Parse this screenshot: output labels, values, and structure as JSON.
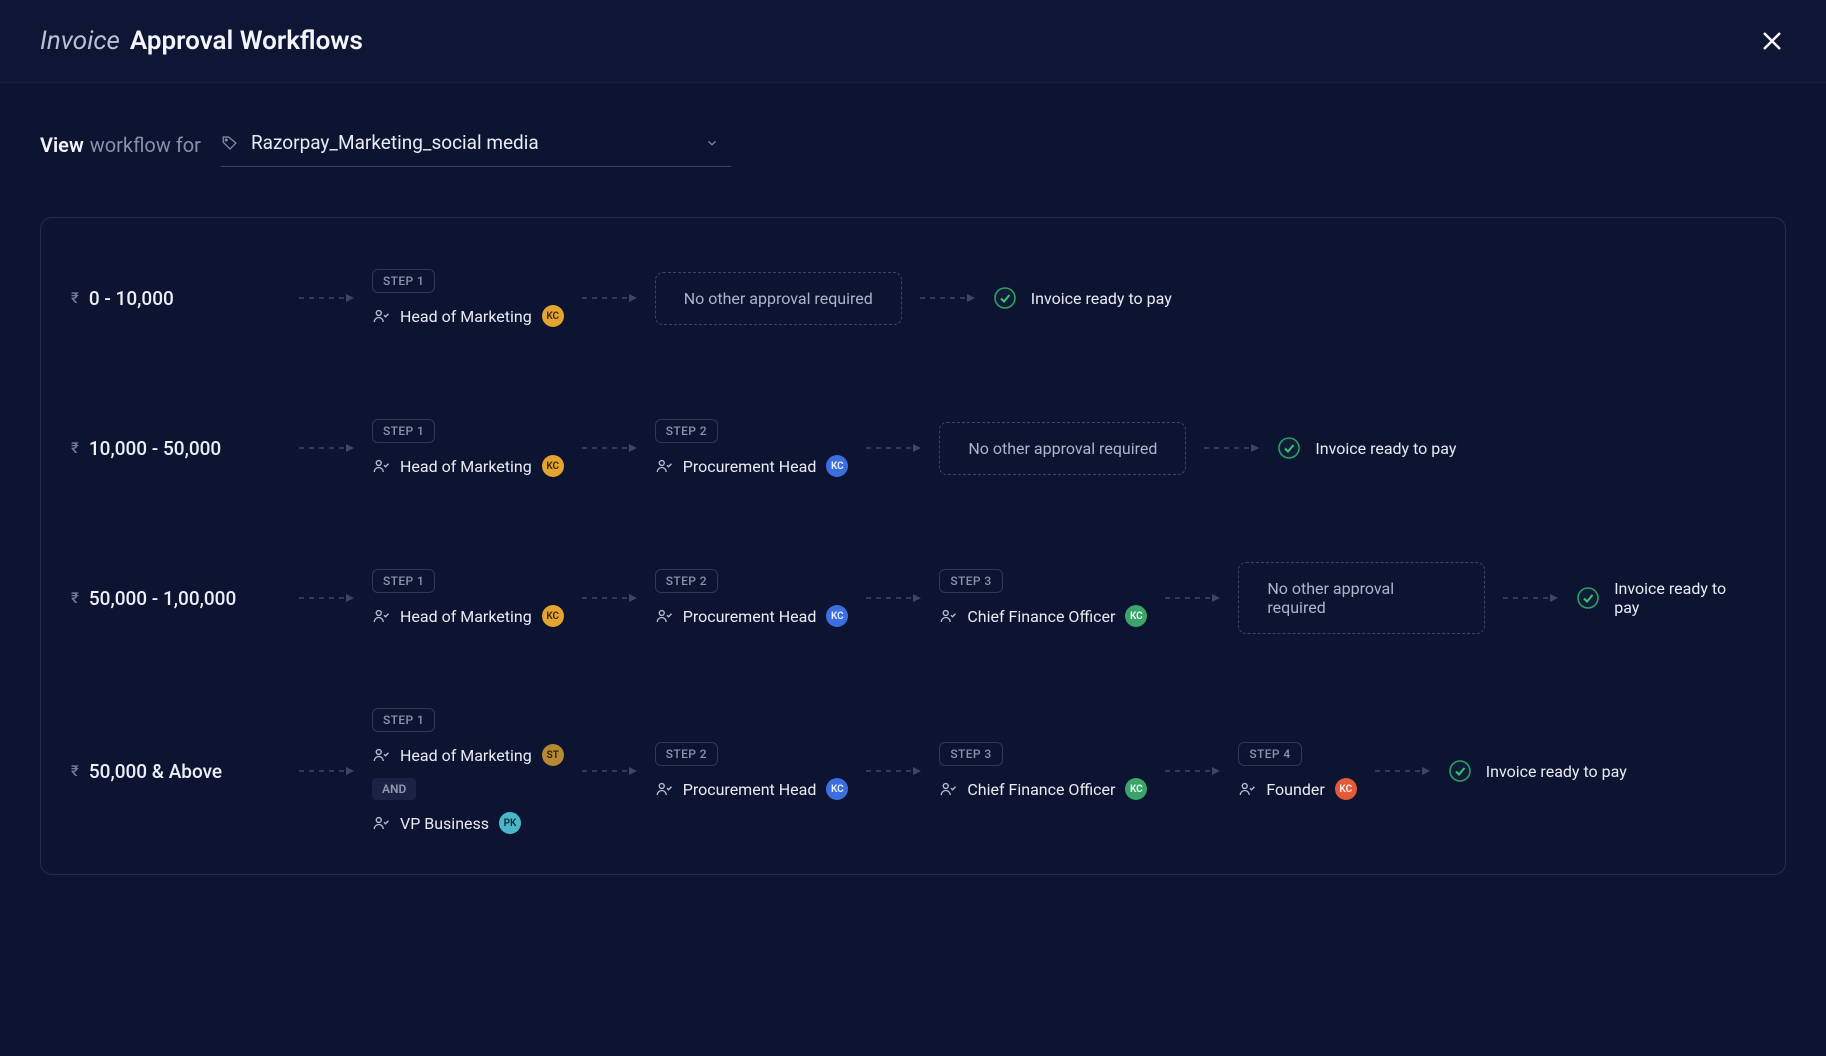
{
  "header": {
    "title_light": "Invoice",
    "title_bold": "Approval Workflows"
  },
  "filter": {
    "label_view": "View",
    "label_workflow_for": "workflow for",
    "selected": "Razorpay_Marketing_social media"
  },
  "common": {
    "no_other_approval": "No other approval required",
    "ready_to_pay": "Invoice ready to pay",
    "and_label": "AND",
    "rupee": "₹"
  },
  "step_labels": [
    "STEP 1",
    "STEP 2",
    "STEP 3",
    "STEP 4"
  ],
  "tiers": [
    {
      "range": "0 - 10,000",
      "steps": [
        {
          "approvers": [
            {
              "role": "Head of Marketing",
              "initials": "KC",
              "color": "amber"
            }
          ]
        }
      ],
      "show_no_approval": true
    },
    {
      "range": "10,000 - 50,000",
      "steps": [
        {
          "approvers": [
            {
              "role": "Head of Marketing",
              "initials": "KC",
              "color": "amber"
            }
          ]
        },
        {
          "approvers": [
            {
              "role": "Procurement Head",
              "initials": "KC",
              "color": "blue"
            }
          ]
        }
      ],
      "show_no_approval": true
    },
    {
      "range": "50,000 - 1,00,000",
      "steps": [
        {
          "approvers": [
            {
              "role": "Head of Marketing",
              "initials": "KC",
              "color": "amber"
            }
          ]
        },
        {
          "approvers": [
            {
              "role": "Procurement Head",
              "initials": "KC",
              "color": "blue"
            }
          ]
        },
        {
          "approvers": [
            {
              "role": "Chief Finance Officer",
              "initials": "KC",
              "color": "green"
            }
          ]
        }
      ],
      "show_no_approval": true
    },
    {
      "range": "50,000 & Above",
      "steps": [
        {
          "approvers": [
            {
              "role": "Head of Marketing",
              "initials": "ST",
              "color": "gold"
            },
            {
              "role": "VP Business",
              "initials": "PK",
              "color": "teal"
            }
          ],
          "and": true
        },
        {
          "approvers": [
            {
              "role": "Procurement Head",
              "initials": "KC",
              "color": "blue"
            }
          ]
        },
        {
          "approvers": [
            {
              "role": "Chief Finance Officer",
              "initials": "KC",
              "color": "green"
            }
          ]
        },
        {
          "approvers": [
            {
              "role": "Founder",
              "initials": "KC",
              "color": "red"
            }
          ]
        }
      ],
      "show_no_approval": false
    }
  ]
}
